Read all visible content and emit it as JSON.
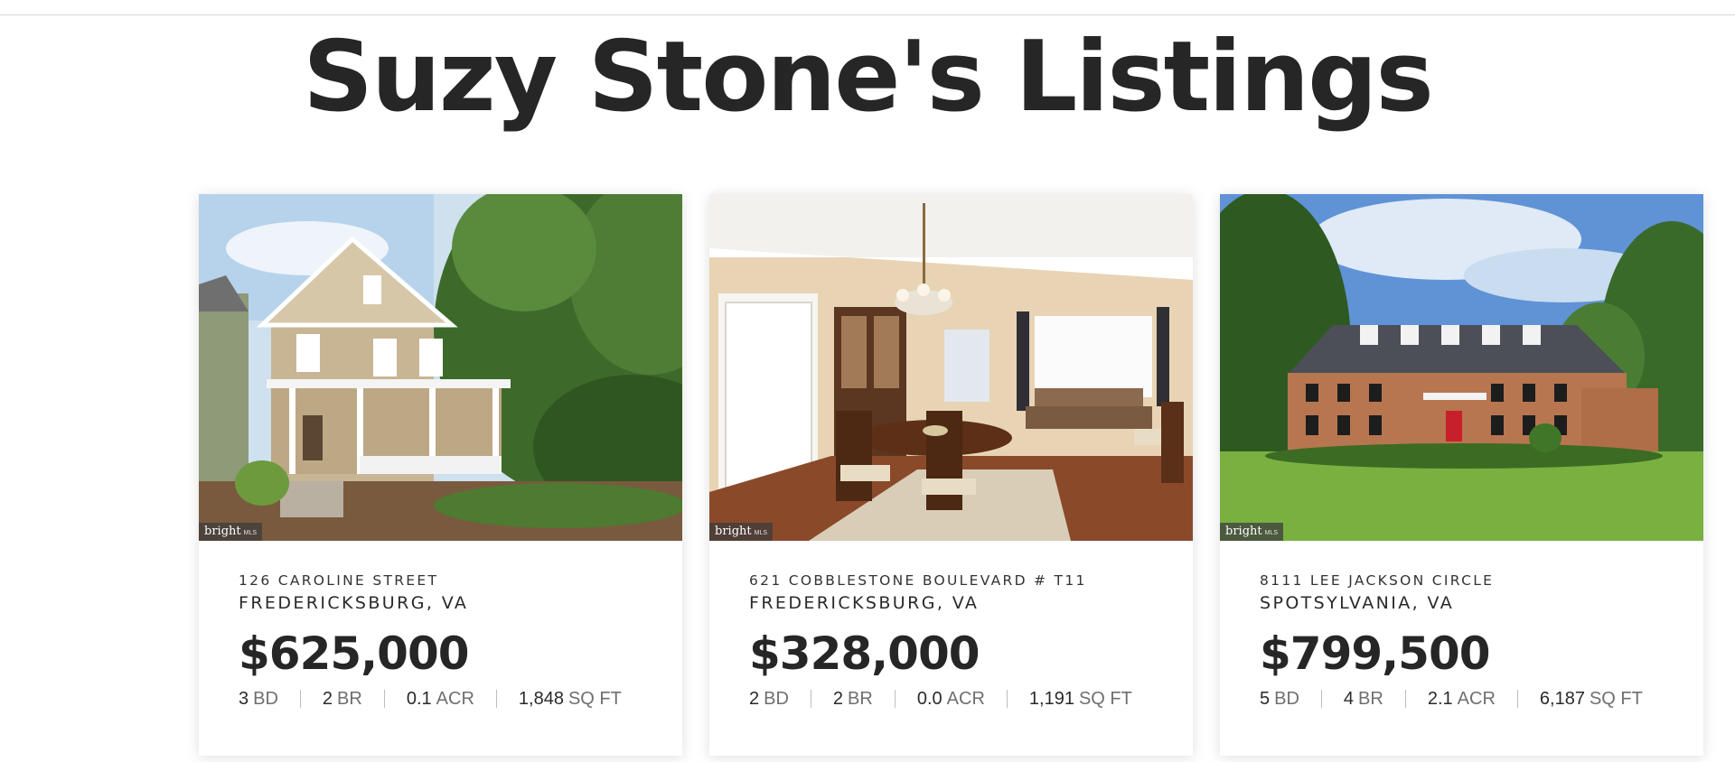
{
  "page_title": "Suzy Stone's Listings",
  "listings": [
    {
      "street": "126 CAROLINE STREET",
      "city": "FREDERICKSBURG, VA",
      "price": "$625,000",
      "badge": "bright",
      "badge_small": "MLS",
      "stats": [
        {
          "value": "3",
          "unit": "BD"
        },
        {
          "value": "2",
          "unit": "BR"
        },
        {
          "value": "0.1",
          "unit": "ACR"
        },
        {
          "value": "1,848",
          "unit": "SQ FT"
        }
      ]
    },
    {
      "street": "621 COBBLESTONE BOULEVARD # T11",
      "city": "FREDERICKSBURG, VA",
      "price": "$328,000",
      "badge": "bright",
      "badge_small": "MLS",
      "stats": [
        {
          "value": "2",
          "unit": "BD"
        },
        {
          "value": "2",
          "unit": "BR"
        },
        {
          "value": "0.0",
          "unit": "ACR"
        },
        {
          "value": "1,191",
          "unit": "SQ FT"
        }
      ]
    },
    {
      "street": "8111 LEE JACKSON CIRCLE",
      "city": "SPOTSYLVANIA, VA",
      "price": "$799,500",
      "badge": "bright",
      "badge_small": "MLS",
      "stats": [
        {
          "value": "5",
          "unit": "BD"
        },
        {
          "value": "4",
          "unit": "BR"
        },
        {
          "value": "2.1",
          "unit": "ACR"
        },
        {
          "value": "6,187",
          "unit": "SQ FT"
        }
      ]
    }
  ]
}
